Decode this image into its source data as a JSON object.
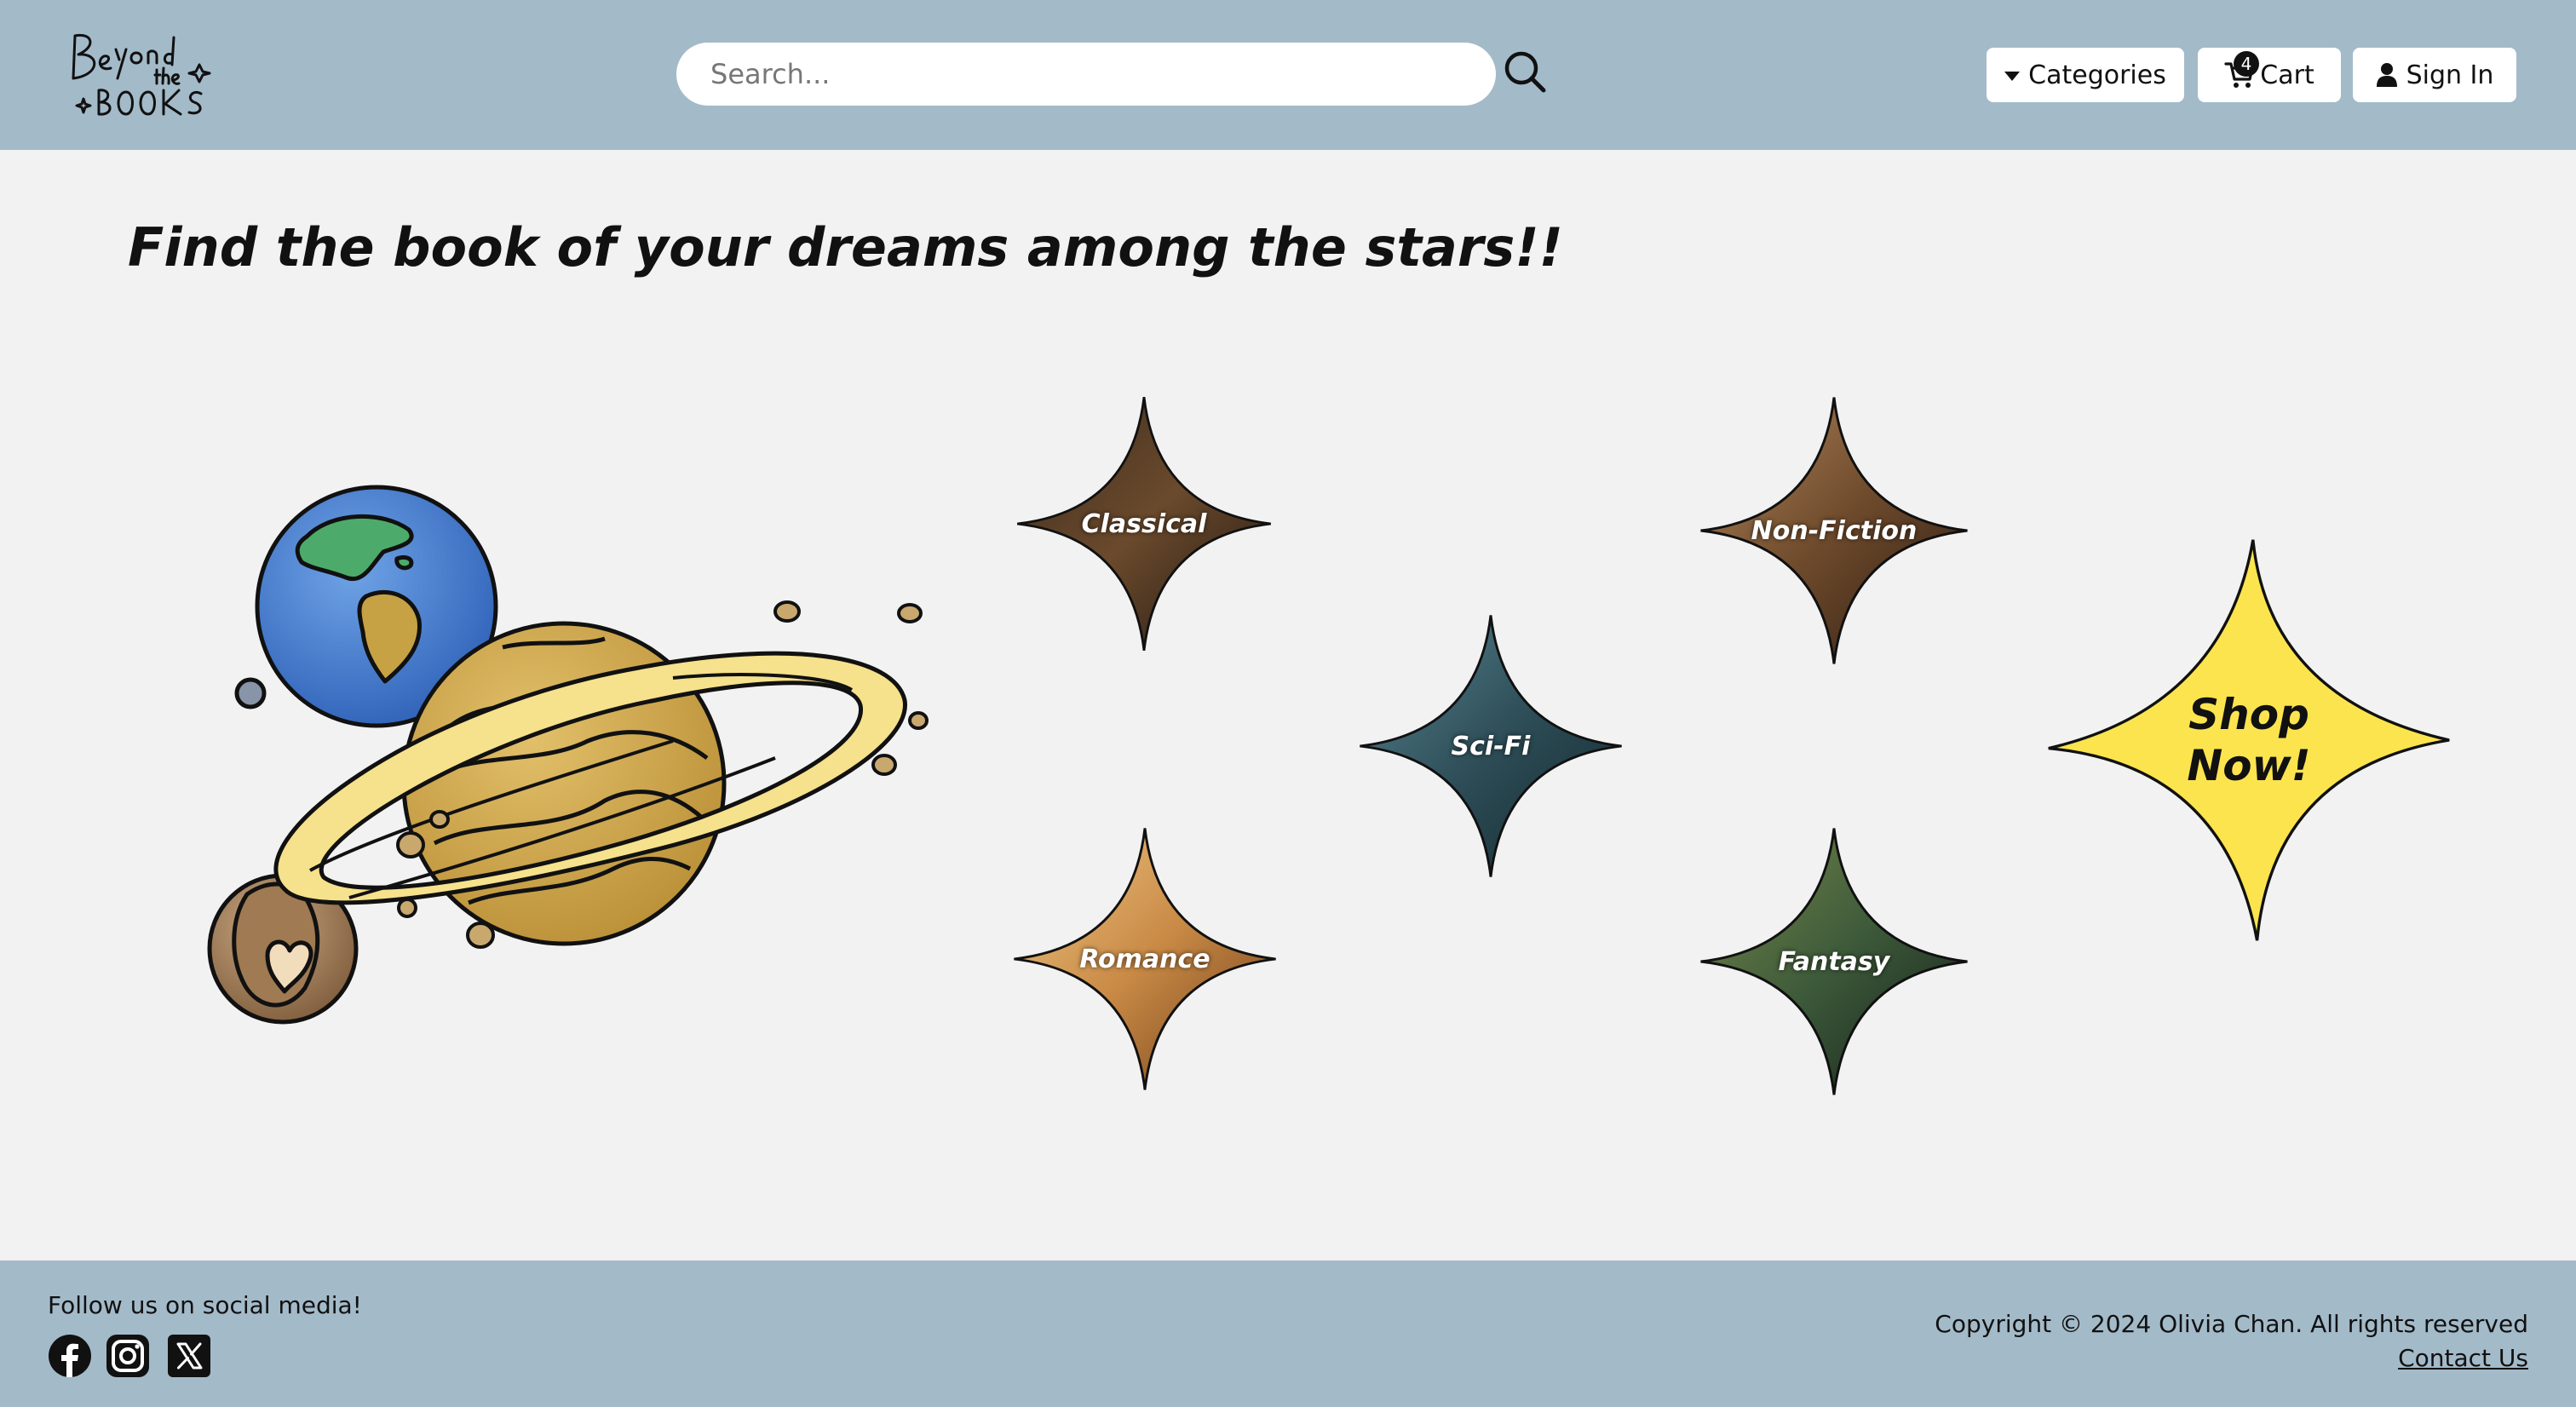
{
  "header": {
    "logo_text": "Beyond the BOOKS",
    "search": {
      "placeholder": "Search...",
      "value": ""
    },
    "categories_label": "Categories",
    "cart_label": "Cart",
    "cart_count": "4",
    "signin_label": "Sign In"
  },
  "main": {
    "headline": "Find the book of your dreams among the stars!!",
    "categories": [
      {
        "label": "Classical",
        "colors": [
          "#3a2a1e",
          "#6b4a2c",
          "#1b1410"
        ]
      },
      {
        "label": "Romance",
        "colors": [
          "#f0c98a",
          "#c98a45",
          "#6a3a18"
        ]
      },
      {
        "label": "Sci-Fi",
        "colors": [
          "#5a8894",
          "#2e4e58",
          "#11252b"
        ]
      },
      {
        "label": "Non-Fiction",
        "colors": [
          "#b48a5c",
          "#6e4a2c",
          "#2a1a10"
        ]
      },
      {
        "label": "Fantasy",
        "colors": [
          "#7a8a4a",
          "#3d5a3a",
          "#141d18"
        ]
      }
    ],
    "shop_now": "Shop Now!"
  },
  "footer": {
    "follow_text": "Follow us on social media!",
    "social": [
      "facebook-icon",
      "instagram-icon",
      "x-icon"
    ],
    "copyright": "Copyright © 2024 Olivia Chan. All rights reserved",
    "contact": "Contact Us"
  },
  "colors": {
    "header_bg": "#a3bac9",
    "page_bg": "#f2f2f2",
    "shop_star": "#fce44f"
  }
}
